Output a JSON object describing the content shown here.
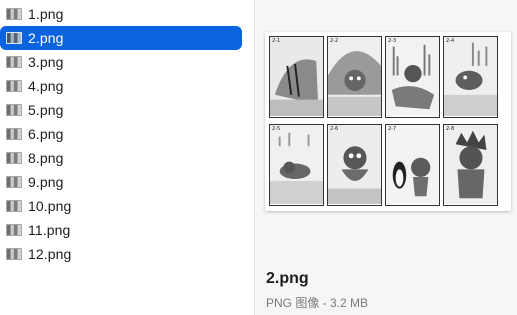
{
  "files": [
    {
      "name": "1.png",
      "selected": false
    },
    {
      "name": "2.png",
      "selected": true
    },
    {
      "name": "3.png",
      "selected": false
    },
    {
      "name": "4.png",
      "selected": false
    },
    {
      "name": "5.png",
      "selected": false
    },
    {
      "name": "6.png",
      "selected": false
    },
    {
      "name": "8.png",
      "selected": false
    },
    {
      "name": "9.png",
      "selected": false
    },
    {
      "name": "10.png",
      "selected": false
    },
    {
      "name": "11.png",
      "selected": false
    },
    {
      "name": "12.png",
      "selected": false
    }
  ],
  "preview": {
    "title": "2.png",
    "subtitle": "PNG 图像 - 3.2 MB",
    "panels": [
      {
        "label": "2-1"
      },
      {
        "label": "2-2"
      },
      {
        "label": "2-3"
      },
      {
        "label": "2-4"
      },
      {
        "label": "2-5"
      },
      {
        "label": "2-6"
      },
      {
        "label": "2-7"
      },
      {
        "label": "2-8"
      }
    ]
  },
  "colors": {
    "selection": "#0a64e0",
    "preview_bg": "#f6f6f6"
  }
}
